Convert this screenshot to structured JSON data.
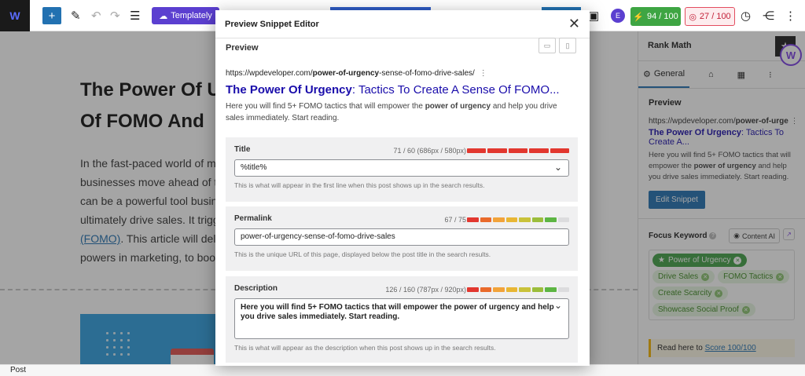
{
  "topbar": {
    "logo_text": "W",
    "templately_label": "Templately",
    "seo_score": "94 / 100",
    "readability_score": "27 / 100",
    "plugin_badge": "E"
  },
  "editor": {
    "title": "The Power Of U... Of FOMO And",
    "title_line1": "The Power Of U",
    "title_line2": "Of FOMO And",
    "body_lines": [
      "In the fast-paced world of mar",
      "businesses move ahead of the",
      "can be a powerful tool busines",
      "ultimately drive sales. It trigge"
    ],
    "body_link": "(FOMO)",
    "body_after_link": ". This article will delve",
    "body_last": "powers in marketing, to boost"
  },
  "status": {
    "label": "Post"
  },
  "sidebar": {
    "header": "Rank Math",
    "tabs": [
      {
        "label": "General"
      }
    ],
    "preview_heading": "Preview",
    "preview_url": "https://wpdeveloper.com/power-of-urge...",
    "preview_url_base": "https://wpdeveloper.com/",
    "preview_url_bold": "power-of-urge",
    "preview_title_bold": "The Power Of Urgency",
    "preview_title_rest": ": Tactics To Create A...",
    "preview_desc_1": "Here you will find 5+ FOMO tactics that will empower the ",
    "preview_desc_bold": "power of urgency",
    "preview_desc_2": " and help you drive sales immediately. Start reading.",
    "edit_snippet": "Edit Snippet",
    "focus_keyword_label": "Focus Keyword",
    "content_ai_label": "Content AI",
    "keywords": [
      "Power of Urgency",
      "Drive Sales",
      "FOMO Tactics",
      "Create Scarcity",
      "Showcase Social Proof"
    ],
    "notice_text": "Read here to ",
    "notice_link": "Score 100/100"
  },
  "modal": {
    "title": "Preview Snippet Editor",
    "preview_label": "Preview",
    "serp_url_base": "https://wpdeveloper.com/",
    "serp_url_bold": "power-of-urgency",
    "serp_url_rest": "-sense-of-fomo-drive-sales/",
    "serp_title_bold": "The Power Of Urgency",
    "serp_title_rest": ": Tactics To Create A Sense Of FOMO...",
    "serp_desc_1": "Here you will find 5+ FOMO tactics that will empower the ",
    "serp_desc_bold": "power of urgency",
    "serp_desc_2": " and help you drive sales immediately. Start reading.",
    "title_field": {
      "label": "Title",
      "count": "71 / 60 (686px / 580px)",
      "value": "%title%",
      "hint": "This is what will appear in the first line when this post shows up in the search results.",
      "bar_colors": [
        "#e2372f",
        "#e2372f",
        "#e2372f",
        "#e2372f",
        "#e2372f"
      ]
    },
    "permalink_field": {
      "label": "Permalink",
      "count": "67 / 75",
      "value": "power-of-urgency-sense-of-fomo-drive-sales",
      "hint": "This is the unique URL of this page, displayed below the post title in the search results.",
      "bar_colors": [
        "#e2372f",
        "#e96a2b",
        "#f2a33a",
        "#e8b634",
        "#c9c23a",
        "#9bbd3b",
        "#5db543",
        "#dcdcde"
      ]
    },
    "description_field": {
      "label": "Description",
      "count": "126 / 160 (787px / 920px)",
      "value": "Here you will find 5+ FOMO tactics that will empower the power of urgency and help you drive sales immediately. Start reading.",
      "hint": "This is what will appear as the description when this post shows up in the search results.",
      "bar_colors": [
        "#e2372f",
        "#e96a2b",
        "#f2a33a",
        "#e8b634",
        "#c9c23a",
        "#9bbd3b",
        "#5db543",
        "#dcdcde"
      ]
    }
  }
}
